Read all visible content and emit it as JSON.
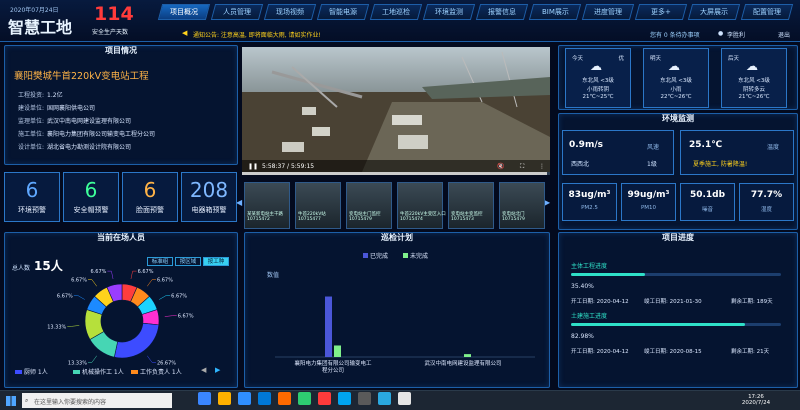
{
  "header": {
    "date": "2020年07月24日",
    "title": "智慧工地",
    "safe_days": "114",
    "safe_label": "安全生产天数",
    "nav": [
      "项目概况",
      "人员管理",
      "现场视频",
      "智能电源",
      "工地巡检",
      "环境监测",
      "报警信息",
      "BIM展示",
      "进度管理",
      "更多+",
      "大屏展示",
      "配置管理"
    ],
    "active_nav": 0
  },
  "notice": {
    "text": "通知公告: 注意高温, 即将面临大雨, 请如实作业!",
    "right": "您有 0 条待办事项",
    "user": "李胜利",
    "logout": "退出"
  },
  "project": {
    "title": "项目情况",
    "name": "襄阳樊城牛首220kV变电站工程",
    "rows": [
      {
        "k": "工程投资:",
        "v": "1.2亿"
      },
      {
        "k": "建设单位:",
        "v": "国网襄阳供电公司"
      },
      {
        "k": "监理单位:",
        "v": "武汉中南电网建设监理有限公司"
      },
      {
        "k": "施工单位:",
        "v": "襄阳电力集团有限公司输变电工程分公司"
      },
      {
        "k": "设计单位:",
        "v": "湖北省电力勘测设计院有限公司"
      }
    ]
  },
  "video": {
    "time": "5:58:37 / 5:59:15"
  },
  "thumbs": [
    "某某新电站主干路\n10715472",
    "牛首220kV站\n10715477",
    "变电站主门监控\n10715479",
    "牛首220kV主变区入口\n10715474",
    "变电站主变监控\n10715473",
    "变电站北门\n10715479"
  ],
  "stats": [
    {
      "n": "6",
      "l": "环境预警",
      "c": "#5fa8ff"
    },
    {
      "n": "6",
      "l": "安全帽预警",
      "c": "#3dff9a"
    },
    {
      "n": "6",
      "l": "脸面预警",
      "c": "#ffb347"
    },
    {
      "n": "208",
      "l": "电器箱预警",
      "c": "#7fb8ff"
    }
  ],
  "weather": [
    {
      "d": "今天",
      "q": "优",
      "w": "东北风 <3级",
      "s": "小雨转阴",
      "t": "21℃~25℃"
    },
    {
      "d": "明天",
      "q": "",
      "w": "东北风 <3级",
      "s": "小雨",
      "t": "22℃~26℃"
    },
    {
      "d": "后天",
      "q": "",
      "w": "东北风 <3级",
      "s": "阴转多云",
      "t": "21℃~26℃"
    }
  ],
  "env": {
    "title": "环境监测",
    "wind_speed": "0.9m/s",
    "wind_label": "风速",
    "wind_dir": "西西北",
    "wind_level": "1级",
    "temp": "25.1℃",
    "temp_label": "温度",
    "temp_tip": "夏季施工, 防暑降温!",
    "cells": [
      {
        "v": "83ug/m³",
        "u": "PM2.5"
      },
      {
        "v": "99ug/m³",
        "u": "PM10"
      },
      {
        "v": "50.1db",
        "u": "噪音"
      },
      {
        "v": "77.7%",
        "u": "湿度"
      }
    ]
  },
  "people": {
    "title": "当前在场人员",
    "total_label": "总人数",
    "total": "15人",
    "tabs": [
      "标准组",
      "按区域",
      "按工种"
    ],
    "active_tab": 2,
    "chart_data": {
      "type": "pie",
      "values": [
        6.67,
        6.67,
        6.67,
        6.67,
        26.67,
        13.33,
        13.33,
        6.67,
        6.67,
        6.67
      ],
      "labels": [
        "6.67%",
        "6.67%",
        "6.67%",
        "6.67%",
        "26.67%",
        "13.33%",
        "13.33%",
        "6.67%",
        "6.67%",
        "6.67%"
      ],
      "colors": [
        "#ff3d3d",
        "#ff8a1c",
        "#1cd3ff",
        "#ff2fd0",
        "#3d4cff",
        "#46d6b4",
        "#b6e03b",
        "#1c8aff",
        "#ffd21c",
        "#9a3dff"
      ]
    },
    "legend": [
      {
        "name": "厨师 1人",
        "c": "#3d4cff"
      },
      {
        "name": "机械操作工 1人",
        "c": "#46d6b4"
      },
      {
        "name": "工作负责人 1人",
        "c": "#ff8a1c"
      }
    ]
  },
  "patrol": {
    "title": "巡检计划",
    "chart_data": {
      "type": "bar",
      "categories": [
        "襄阳电力集团有限公司输变电工程分公司",
        "武汉中南电网建设监理有限公司"
      ],
      "series": [
        {
          "name": "已完成",
          "values": [
            42,
            0
          ],
          "color": "#4b57d9"
        },
        {
          "name": "未完成",
          "values": [
            8,
            2
          ],
          "color": "#7ff08b"
        }
      ],
      "ymax": 50
    },
    "ylabel": "数值"
  },
  "progress": {
    "title": "项目进度",
    "items": [
      {
        "name": "主体工程进度",
        "pct": 0.354,
        "pct_text": "35.40%",
        "start": "开工日期: 2020-04-12",
        "end": "竣工日期: 2021-01-30",
        "left": "剩余工期: 189天"
      },
      {
        "name": "土建施工进度",
        "pct": 0.8298,
        "pct_text": "82.98%",
        "start": "开工日期: 2020-04-12",
        "end": "竣工日期: 2020-08-15",
        "left": "剩余工期: 21天"
      }
    ]
  },
  "taskbar": {
    "search": "在这里输入你要搜索的内容",
    "time": "17:26",
    "date": "2020/7/24"
  }
}
